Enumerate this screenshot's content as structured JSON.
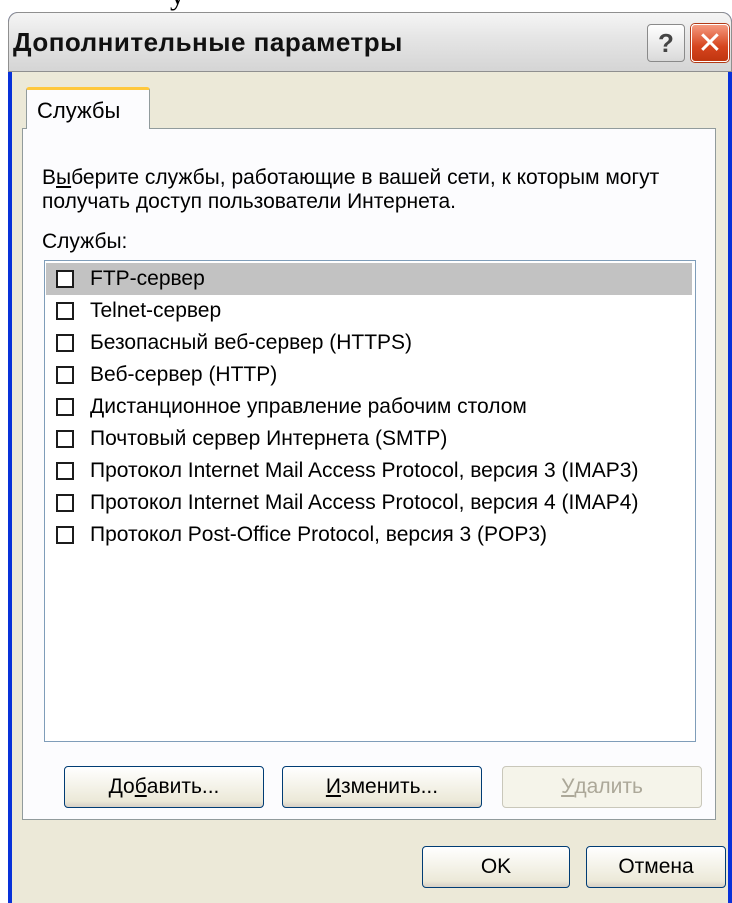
{
  "top_sliver_text": "у",
  "window": {
    "title": "Дополнительные параметры",
    "help_glyph": "?",
    "close_glyph": "✕"
  },
  "tab": {
    "label": "Службы"
  },
  "description": {
    "pre": "В",
    "accel": "ы",
    "post": "берите службы, работающие в вашей сети, к которым могут получать доступ пользователи Интернета."
  },
  "services_label": "Службы:",
  "services": [
    {
      "label": "FTP-сервер",
      "checked": false,
      "selected": true
    },
    {
      "label": "Telnet-сервер",
      "checked": false,
      "selected": false
    },
    {
      "label": "Безопасный веб-сервер (HTTPS)",
      "checked": false,
      "selected": false
    },
    {
      "label": "Веб-сервер (HTTP)",
      "checked": false,
      "selected": false
    },
    {
      "label": "Дистанционное управление рабочим столом",
      "checked": false,
      "selected": false
    },
    {
      "label": "Почтовый сервер Интернета (SMTP)",
      "checked": false,
      "selected": false
    },
    {
      "label": "Протокол Internet Mail Access Protocol, версия 3 (IMAP3)",
      "checked": false,
      "selected": false
    },
    {
      "label": "Протокол Internet Mail Access Protocol, версия 4 (IMAP4)",
      "checked": false,
      "selected": false
    },
    {
      "label": "Протокол Post-Office Protocol, версия 3 (POP3)",
      "checked": false,
      "selected": false
    }
  ],
  "buttons": {
    "add": {
      "pre": "До",
      "accel": "б",
      "post": "авить..."
    },
    "edit": {
      "pre": "",
      "accel": "И",
      "post": "зменить..."
    },
    "delete": {
      "pre": "",
      "accel": "У",
      "post": "далить",
      "disabled": true
    },
    "ok": "OK",
    "cancel": "Отмена"
  },
  "colors": {
    "title_bar": "#e6e6e6",
    "dialog_bg": "#ece9d8",
    "close_button": "#d6451e",
    "tab_accent": "#ffc83c",
    "selection": "#c2c2c2"
  }
}
